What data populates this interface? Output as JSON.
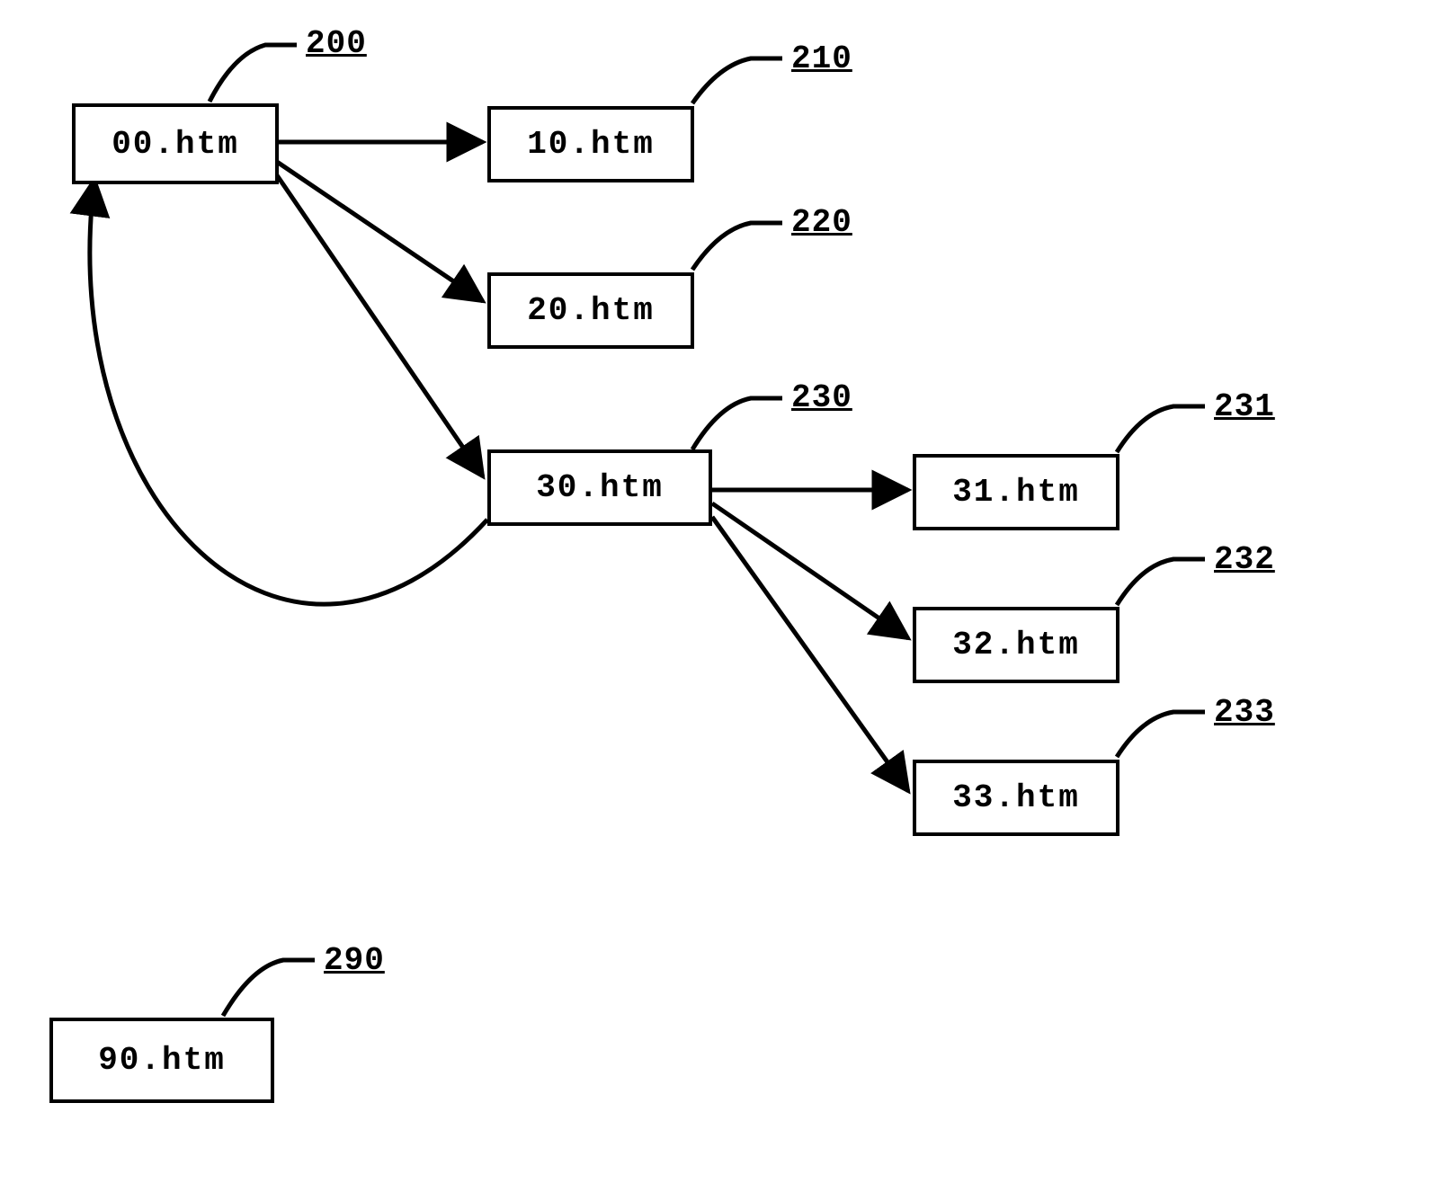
{
  "nodes": {
    "n200": {
      "label": "00.htm",
      "ref": "200"
    },
    "n210": {
      "label": "10.htm",
      "ref": "210"
    },
    "n220": {
      "label": "20.htm",
      "ref": "220"
    },
    "n230": {
      "label": "30.htm",
      "ref": "230"
    },
    "n231": {
      "label": "31.htm",
      "ref": "231"
    },
    "n232": {
      "label": "32.htm",
      "ref": "232"
    },
    "n233": {
      "label": "33.htm",
      "ref": "233"
    },
    "n290": {
      "label": "90.htm",
      "ref": "290"
    }
  },
  "edges": [
    {
      "from": "n200",
      "to": "n210"
    },
    {
      "from": "n200",
      "to": "n220"
    },
    {
      "from": "n200",
      "to": "n230"
    },
    {
      "from": "n230",
      "to": "n200",
      "style": "curve"
    },
    {
      "from": "n230",
      "to": "n231"
    },
    {
      "from": "n230",
      "to": "n232"
    },
    {
      "from": "n230",
      "to": "n233"
    }
  ]
}
